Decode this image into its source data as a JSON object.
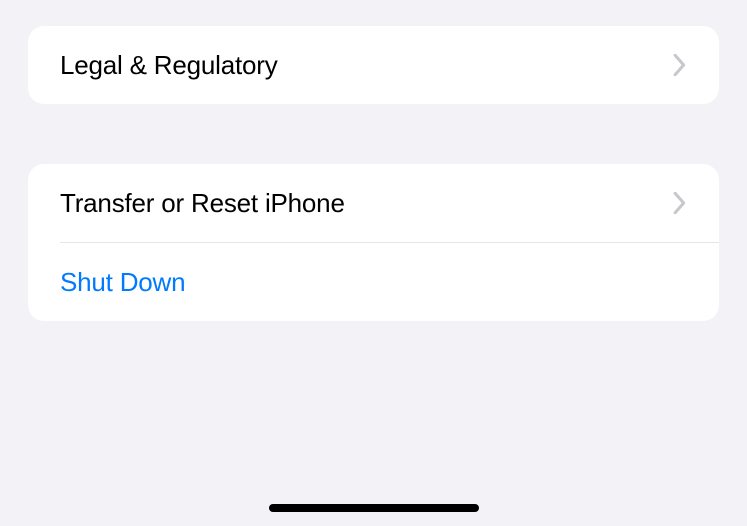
{
  "groups": [
    {
      "items": [
        {
          "label": "Legal & Regulatory",
          "hasChevron": true,
          "style": "default"
        }
      ]
    },
    {
      "items": [
        {
          "label": "Transfer or Reset iPhone",
          "hasChevron": true,
          "style": "default"
        },
        {
          "label": "Shut Down",
          "hasChevron": false,
          "style": "link"
        }
      ]
    }
  ]
}
